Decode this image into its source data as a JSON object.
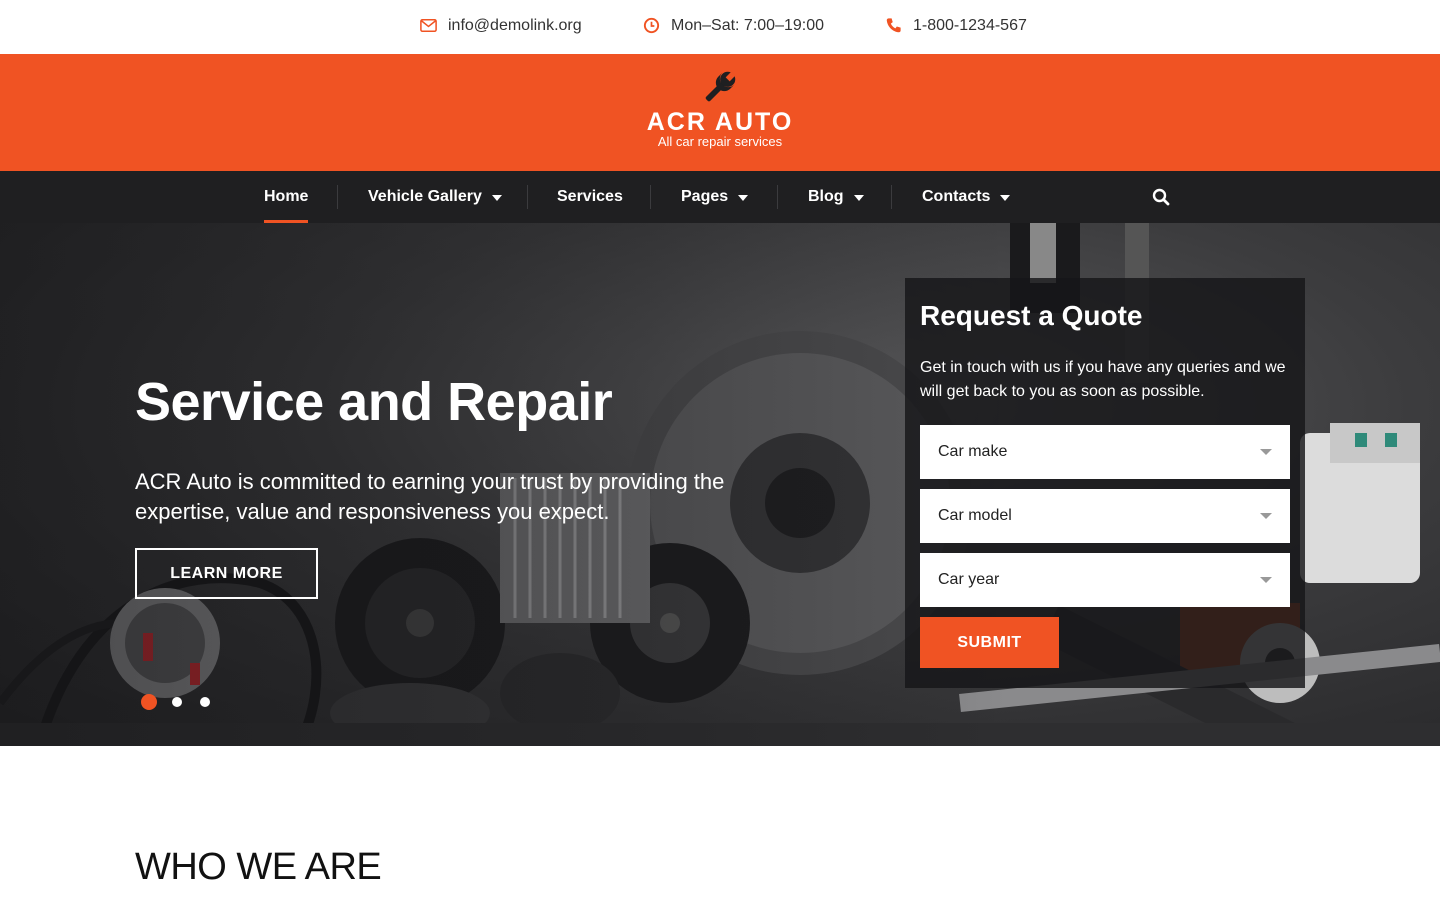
{
  "topbar": {
    "email": "info@demolink.org",
    "hours": "Mon–Sat: 7:00–19:00",
    "phone": "1-800-1234-567"
  },
  "brand": {
    "name": "ACR AUTO",
    "tagline": "All car repair services",
    "logo_icon": "wrench-icon"
  },
  "nav": {
    "items": [
      {
        "label": "Home",
        "active": true,
        "dropdown": false
      },
      {
        "label": "Vehicle Gallery",
        "active": false,
        "dropdown": true
      },
      {
        "label": "Services",
        "active": false,
        "dropdown": false
      },
      {
        "label": "Pages",
        "active": false,
        "dropdown": true
      },
      {
        "label": "Blog",
        "active": false,
        "dropdown": true
      },
      {
        "label": "Contacts",
        "active": false,
        "dropdown": true
      }
    ],
    "search_icon": "search-icon"
  },
  "hero": {
    "title": "Service and Repair",
    "text": "ACR Auto is committed to earning your trust by providing the expertise, value and responsiveness you expect.",
    "button": "LEARN MORE",
    "slides": 3,
    "active_slide": 1
  },
  "quote": {
    "title": "Request a Quote",
    "text": "Get in touch with us if you have any queries and we will get back to you as soon as possible.",
    "fields": [
      "Car make",
      "Car model",
      "Car year"
    ],
    "submit": "SUBMIT"
  },
  "section": {
    "title": "WHO WE ARE"
  },
  "colors": {
    "accent": "#f05323",
    "nav_bg": "#1f1f21"
  }
}
